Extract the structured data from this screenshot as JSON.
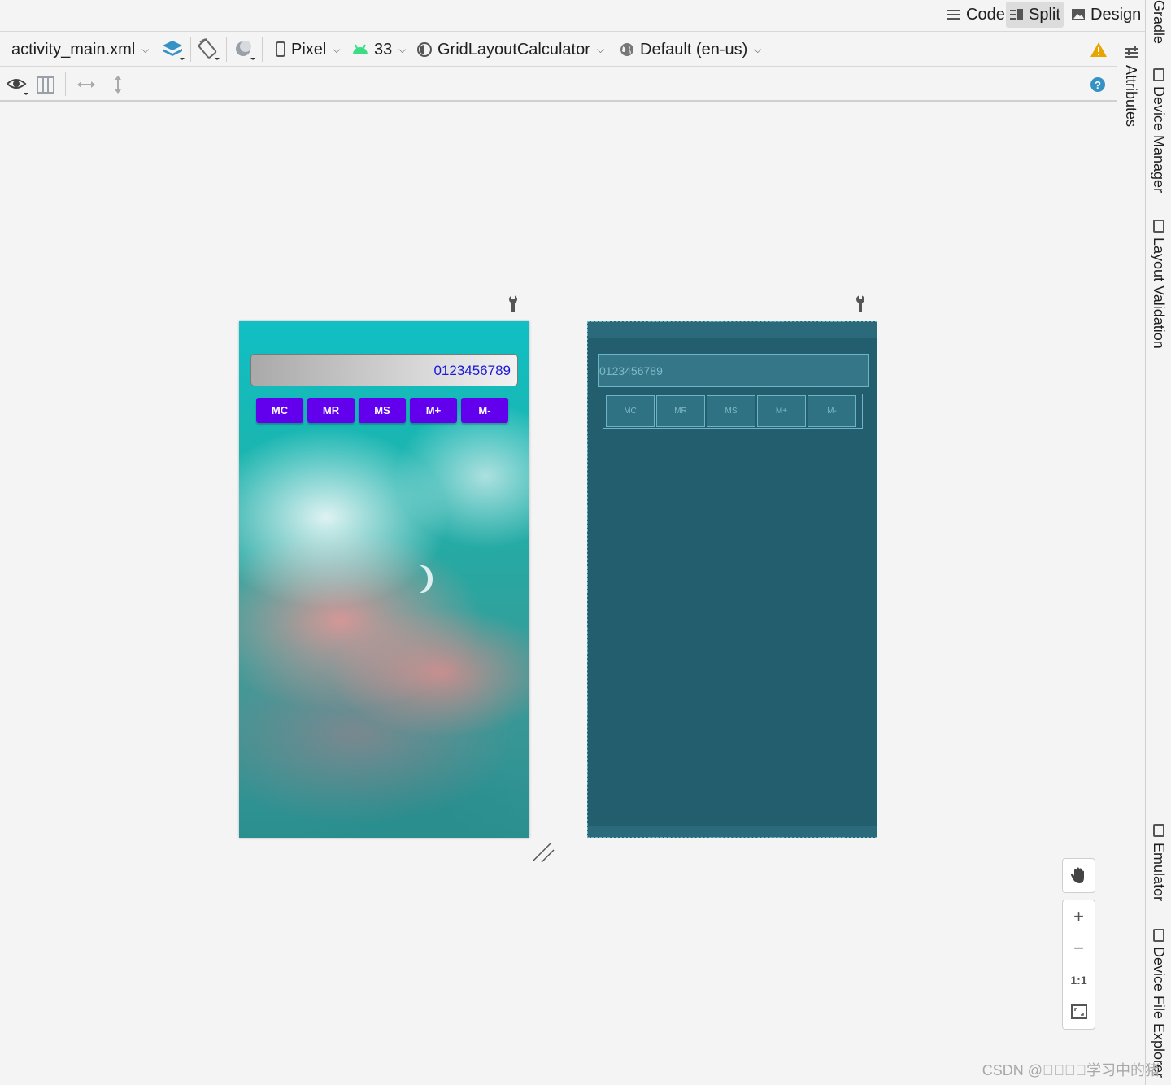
{
  "view_modes": {
    "code": "Code",
    "split": "Split",
    "design": "Design",
    "active": "split"
  },
  "toolbar": {
    "file": "activity_main.xml",
    "device": "Pixel",
    "api_level": "33",
    "theme": "GridLayoutCalculator",
    "locale": "Default (en-us)"
  },
  "design_preview": {
    "display_text": "0123456789",
    "memory_keys": [
      "MC",
      "MR",
      "MS",
      "M+",
      "M-"
    ]
  },
  "blueprint_preview": {
    "display_text": "0123456789",
    "memory_keys": [
      "MC",
      "MR",
      "MS",
      "M+",
      "M-"
    ]
  },
  "side_tabs": {
    "gradle": "Gradle",
    "attributes": "Attributes",
    "device_manager": "Device Manager",
    "layout_validation": "Layout Validation",
    "emulator": "Emulator",
    "device_file_explorer": "Device File Explorer"
  },
  "zoom": {
    "actual_size": "1:1"
  },
  "watermark": "CSDN @\u0000\u0000\u0000\u0000学习中的猪",
  "colors": {
    "accent_button": "#6200ee",
    "display_text": "#1a18d6",
    "blueprint_bg": "#235e6f",
    "warning": "#e8a400",
    "help": "#3592c4"
  }
}
